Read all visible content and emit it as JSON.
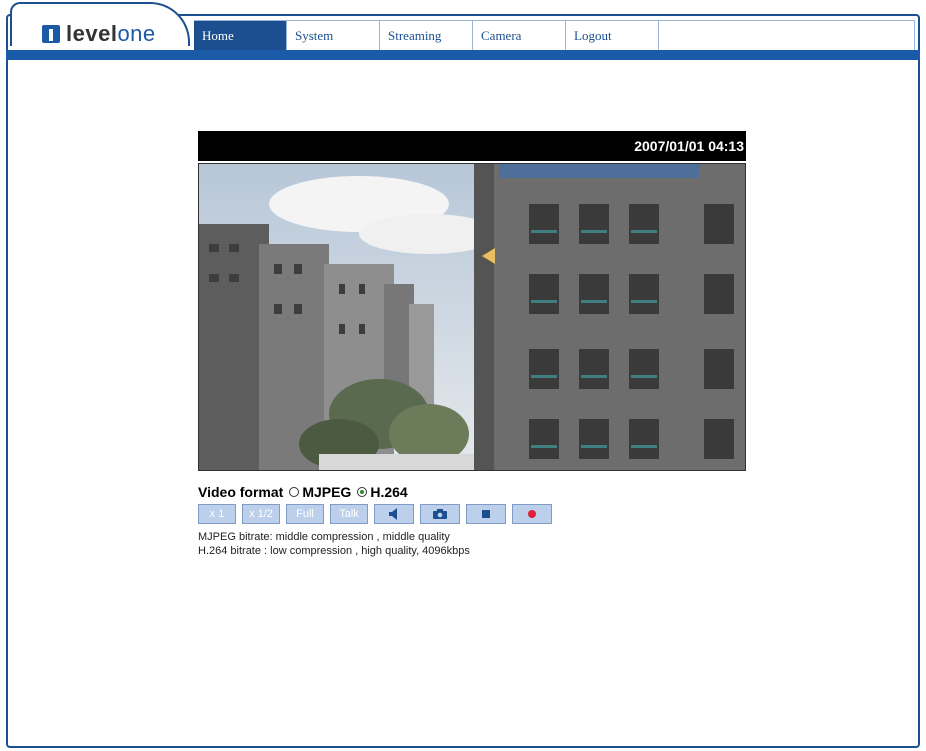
{
  "brand": {
    "level": "level",
    "one": "one"
  },
  "nav": {
    "items": [
      {
        "label": "Home",
        "active": true
      },
      {
        "label": "System",
        "active": false
      },
      {
        "label": "Streaming",
        "active": false
      },
      {
        "label": "Camera",
        "active": false
      },
      {
        "label": "Logout",
        "active": false
      }
    ]
  },
  "video": {
    "timestamp": "2007/01/01 04:13"
  },
  "format": {
    "label": "Video format",
    "options": [
      {
        "label": "MJPEG",
        "selected": false
      },
      {
        "label": "H.264",
        "selected": true
      }
    ]
  },
  "buttons": {
    "x1": "x 1",
    "x12": "x 1/2",
    "full": "Full",
    "talk": "Talk",
    "icons": [
      "speaker-icon",
      "camera-icon",
      "stop-icon",
      "record-icon"
    ]
  },
  "info": {
    "mjpeg": "MJPEG bitrate: middle compression , middle quality",
    "h264": "H.264 bitrate  : low compression , high quality, 4096kbps"
  },
  "colors": {
    "brand": "#1b4f8f",
    "button": "#bcd0ec"
  }
}
